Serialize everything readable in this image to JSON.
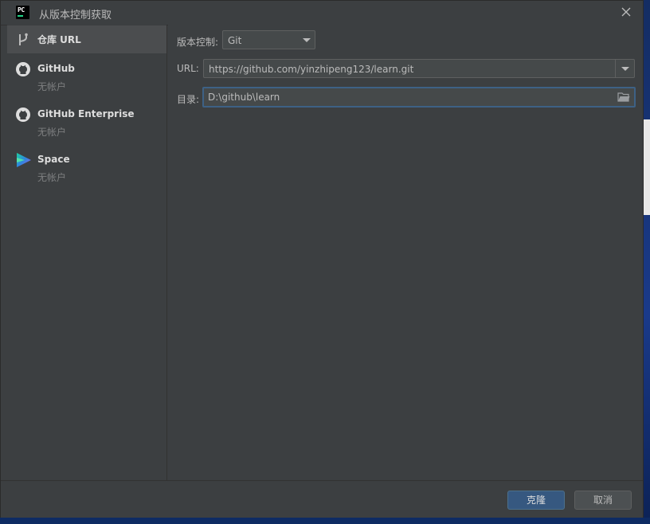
{
  "window": {
    "title": "从版本控制获取"
  },
  "app_icon": {
    "text": "PC"
  },
  "sidebar": {
    "items": [
      {
        "label": "仓库 URL",
        "icon": "vcs-branch-icon"
      },
      {
        "label": "GitHub",
        "sub": "无帐户",
        "icon": "github-icon"
      },
      {
        "label": "GitHub Enterprise",
        "sub": "无帐户",
        "icon": "github-icon"
      },
      {
        "label": "Space",
        "sub": "无帐户",
        "icon": "space-icon"
      }
    ]
  },
  "form": {
    "vcs_label": "版本控制:",
    "vcs_value": "Git",
    "url_label": "URL:",
    "url_value": "https://github.com/yinzhipeng123/learn.git",
    "dir_label": "目录:",
    "dir_value": "D:\\github\\learn"
  },
  "footer": {
    "clone_label": "克隆",
    "cancel_label": "取消"
  },
  "colors": {
    "background": "#3c3f41",
    "selected": "#4b4d4f",
    "primary_button": "#365880",
    "focus_border": "#3d6185"
  }
}
